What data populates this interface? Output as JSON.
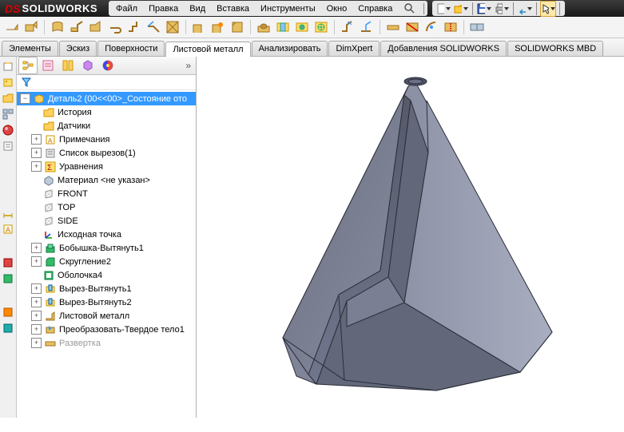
{
  "app": {
    "logo_ds": "DS",
    "logo_sw": "SOLIDWORKS"
  },
  "menu": {
    "file": "Файл",
    "edit": "Правка",
    "view": "Вид",
    "insert": "Вставка",
    "tools": "Инструменты",
    "window": "Окно",
    "help": "Справка"
  },
  "ribbon": {
    "tabs": {
      "elements": "Элементы",
      "sketch": "Эскиз",
      "surfaces": "Поверхности",
      "sheetmetal": "Листовой металл",
      "analyze": "Анализировать",
      "dimxpert": "DimXpert",
      "addins": "Добавления SOLIDWORKS",
      "mbd": "SOLIDWORKS MBD"
    }
  },
  "tree": {
    "root": "Деталь2  (00<<00>_Состояние ото",
    "items": [
      {
        "label": "История",
        "icon": "folder"
      },
      {
        "label": "Датчики",
        "icon": "folder"
      },
      {
        "label": "Примечания",
        "icon": "note",
        "expandable": true
      },
      {
        "label": "Список вырезов(1)",
        "icon": "cutlist",
        "expandable": true
      },
      {
        "label": "Уравнения",
        "icon": "sigma",
        "expandable": true
      },
      {
        "label": "Материал <не указан>",
        "icon": "material"
      },
      {
        "label": "FRONT",
        "icon": "plane"
      },
      {
        "label": "TOP",
        "icon": "plane"
      },
      {
        "label": "SIDE",
        "icon": "plane"
      },
      {
        "label": "Исходная точка",
        "icon": "origin"
      },
      {
        "label": "Бобышка-Вытянуть1",
        "icon": "boss",
        "expandable": true
      },
      {
        "label": "Скругление2",
        "icon": "fillet",
        "expandable": true
      },
      {
        "label": "Оболочка4",
        "icon": "shell"
      },
      {
        "label": "Вырез-Вытянуть1",
        "icon": "cut",
        "expandable": true
      },
      {
        "label": "Вырез-Вытянуть2",
        "icon": "cut",
        "expandable": true
      },
      {
        "label": "Листовой металл",
        "icon": "sheet",
        "expandable": true
      },
      {
        "label": "Преобразовать-Твердое тело1",
        "icon": "convert",
        "expandable": true
      },
      {
        "label": "Развертка",
        "icon": "flat",
        "expandable": true,
        "muted": true
      }
    ]
  }
}
